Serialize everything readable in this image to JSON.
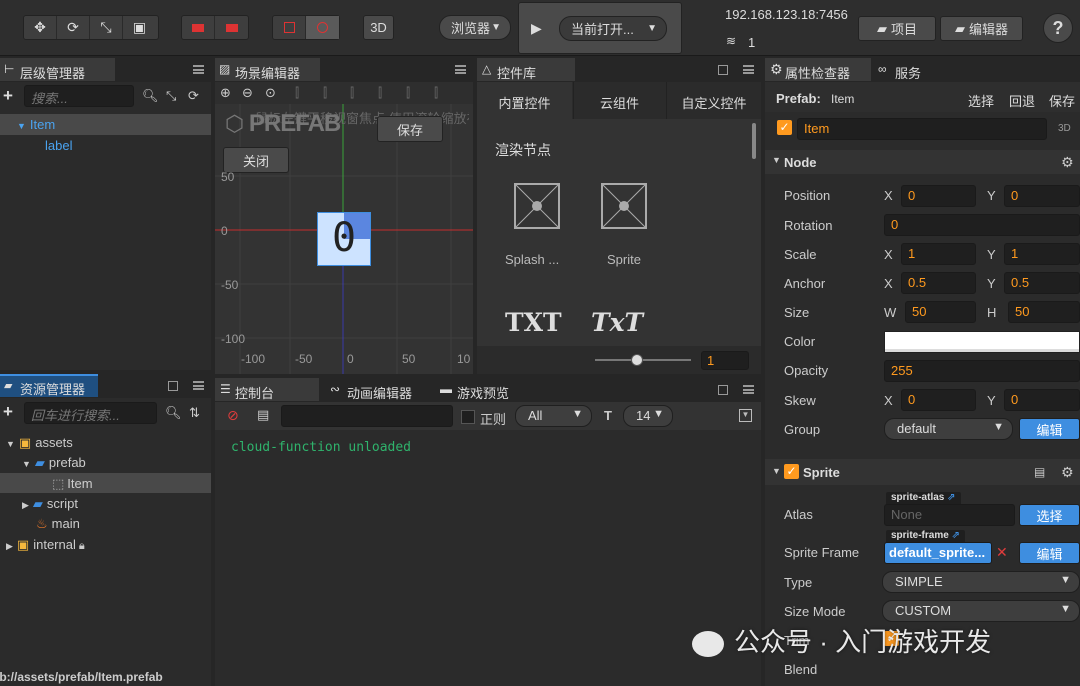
{
  "toolbar": {
    "tool_icons": [
      "move-icon",
      "rotate-icon",
      "scale-icon",
      "rect-icon"
    ],
    "mode_3d": "3D",
    "browser_select": "浏览器",
    "play_icon": "▶",
    "open_current": "当前打开...",
    "ip": "192.168.123.18:7456",
    "wifi_count": "1",
    "project_btn": "项目",
    "editor_btn": "编辑器",
    "help": "?"
  },
  "hierarchy": {
    "title": "层级管理器",
    "search_placeholder": "搜索...",
    "items": [
      {
        "label": "Item",
        "selected": true
      },
      {
        "label": "label",
        "selected": false
      }
    ]
  },
  "scene": {
    "title": "场景编辑器",
    "hint": "鼠标左键平移视窗焦点,使用滚轮缩放视图",
    "prefab_watermark": "PREFAB",
    "save_btn": "保存",
    "close_btn": "关闭",
    "node_text": "0",
    "y_ticks": [
      "50",
      "0",
      "-50",
      "-100"
    ],
    "x_ticks": [
      "-100",
      "-50",
      "0",
      "50",
      "10"
    ]
  },
  "widgets": {
    "title": "控件库",
    "tabs": [
      "内置控件",
      "云组件",
      "自定义控件"
    ],
    "section": "渲染节点",
    "items": [
      {
        "label": "Splash ..."
      },
      {
        "label": "Sprite"
      }
    ],
    "text_items": [
      "TXT",
      "TxT"
    ],
    "zoom_value": "1"
  },
  "inspector": {
    "title": "属性检查器",
    "service_tab": "服务",
    "prefab_label": "Prefab:",
    "prefab_name": "Item",
    "select": "选择",
    "revert": "回退",
    "save": "保存",
    "node_name": "Item",
    "badge_3d": "3D",
    "node_section": "Node",
    "position": {
      "label": "Position",
      "x": "0",
      "y": "0"
    },
    "rotation": {
      "label": "Rotation",
      "value": "0"
    },
    "scale": {
      "label": "Scale",
      "x": "1",
      "y": "1"
    },
    "anchor": {
      "label": "Anchor",
      "x": "0.5",
      "y": "0.5"
    },
    "size": {
      "label": "Size",
      "w": "50",
      "h": "50"
    },
    "color": {
      "label": "Color",
      "value": "#ffffff"
    },
    "opacity": {
      "label": "Opacity",
      "value": "255"
    },
    "skew": {
      "label": "Skew",
      "x": "0",
      "y": "0"
    },
    "group": {
      "label": "Group",
      "value": "default",
      "edit": "编辑"
    },
    "sprite_section": "Sprite",
    "atlas": {
      "label": "Atlas",
      "tag": "sprite-atlas",
      "value": "None",
      "btn": "选择"
    },
    "sprite_frame": {
      "label": "Sprite Frame",
      "tag": "sprite-frame",
      "value": "default_sprite...",
      "btn": "编辑"
    },
    "type": {
      "label": "Type",
      "value": "SIMPLE"
    },
    "size_mode": {
      "label": "Size Mode",
      "value": "CUSTOM"
    },
    "trim": {
      "label": "Trim"
    },
    "blend": {
      "label": "Blend"
    }
  },
  "assets": {
    "title": "资源管理器",
    "search_placeholder": "回车进行搜索...",
    "items": [
      {
        "label": "assets"
      },
      {
        "label": "prefab"
      },
      {
        "label": "Item"
      },
      {
        "label": "script"
      },
      {
        "label": "main"
      },
      {
        "label": "internal"
      }
    ],
    "path": "db://assets/prefab/Item.prefab"
  },
  "console": {
    "tabs": [
      "控制台",
      "动画编辑器",
      "游戏预览"
    ],
    "regex_label": "正则",
    "level": "All",
    "font_size": "14",
    "log": "cloud-function unloaded"
  },
  "watermark": "公众号 · 入门游戏开发"
}
